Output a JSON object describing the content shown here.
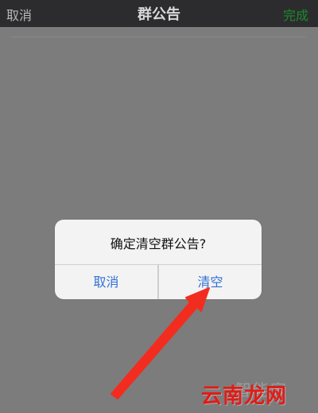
{
  "navbar": {
    "cancel_label": "取消",
    "title": "群公告",
    "done_label": "完成",
    "done_color": "#1b8a2b"
  },
  "dialog": {
    "message": "确定清空群公告?",
    "cancel_label": "取消",
    "clear_label": "清空",
    "button_color": "#2f71d6"
  },
  "overlay": {
    "arrow_icon": "red-pointer-arrow-icon"
  },
  "watermark": {
    "text": "云南龙网",
    "faint_text": "智能家",
    "color": "#e21b16"
  }
}
